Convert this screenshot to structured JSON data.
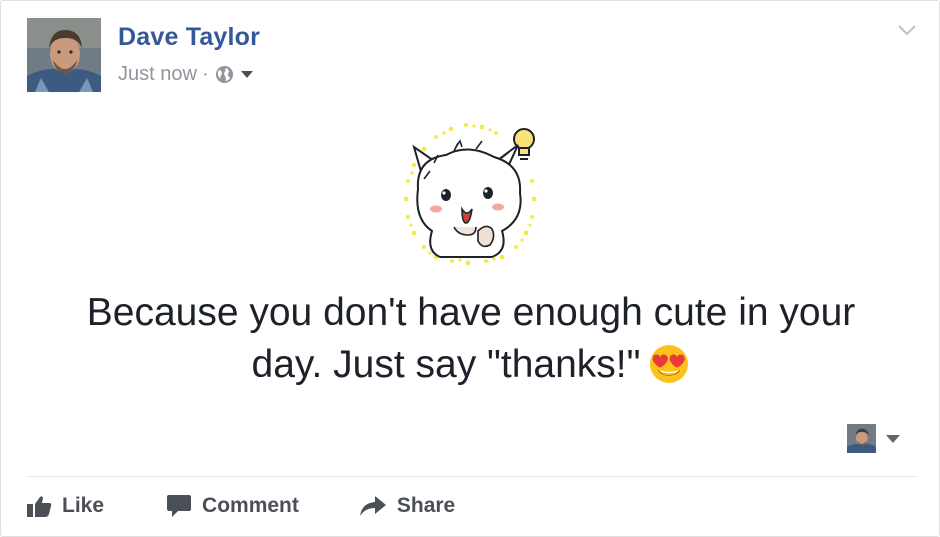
{
  "post": {
    "author": "Dave Taylor",
    "timestamp": "Just now",
    "separator": "·",
    "audience_icon": "globe-icon",
    "text_line1": "Because you don't have enough cute in your",
    "text_line2": "day. Just say \"thanks!\"",
    "emoji": "heart-eyes-emoji",
    "sticker": "cat-lightbulb-sticker"
  },
  "actions": {
    "like_label": "Like",
    "comment_label": "Comment",
    "share_label": "Share"
  },
  "colors": {
    "author_link": "#365899",
    "meta_text": "#90949c",
    "action_text": "#4b4f56",
    "body_text": "#1d2129",
    "sticker_dots": "#f5e84a"
  }
}
